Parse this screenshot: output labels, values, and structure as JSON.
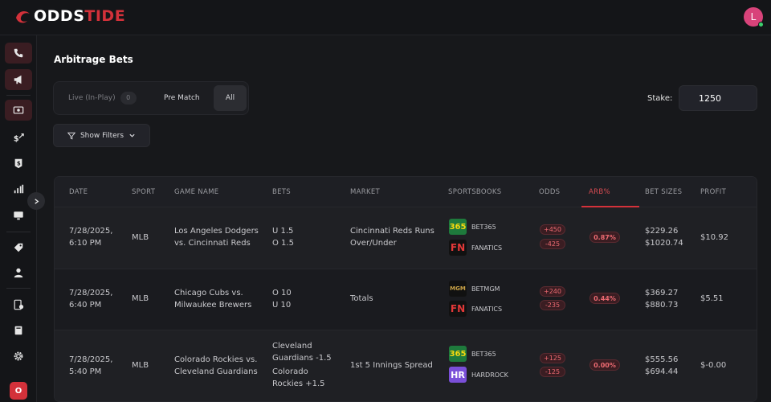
{
  "brand": {
    "logo_prefix": "ODDS",
    "logo_suffix": "TIDE"
  },
  "user": {
    "avatar_initial": "L"
  },
  "page": {
    "title": "Arbitrage Bets"
  },
  "mode_tabs": {
    "live_label": "Live (In-Play)",
    "live_count": "0",
    "prematch_label": "Pre Match",
    "all_label": "All",
    "selected": "All"
  },
  "stake": {
    "label": "Stake:",
    "value": "1250"
  },
  "filters": {
    "label": "Show Filters"
  },
  "sidebar_bottom": {
    "label": "O"
  },
  "table": {
    "headers": {
      "date": "DATE",
      "sport": "SPORT",
      "game": "GAME NAME",
      "bets": "BETS",
      "market": "MARKET",
      "books": "SPORTSBOOKS",
      "odds": "ODDS",
      "arb": "ARB%",
      "sizes": "BET SIZES",
      "profit": "PROFIT"
    },
    "rows": [
      {
        "date": "7/28/2025,",
        "time": "6:10 PM",
        "sport": "MLB",
        "game1": "Los Angeles Dodgers",
        "game2": "vs. Cincinnati Reds",
        "bet1": "U 1.5",
        "bet2": "O 1.5",
        "market1": "Cincinnati Reds Runs",
        "market2": "Over/Under",
        "book1_logo": "365",
        "book1": "BET365",
        "book2_logo": "FN",
        "book2": "FANATICS",
        "odds1": "+450",
        "odds2": "-425",
        "arb": "0.87%",
        "size1": "$229.26",
        "size2": "$1020.74",
        "profit": "$10.92"
      },
      {
        "date": "7/28/2025,",
        "time": "6:40 PM",
        "sport": "MLB",
        "game1": "Chicago Cubs vs.",
        "game2": "Milwaukee Brewers",
        "bet1": "O 10",
        "bet2": "U 10",
        "market1": "Totals",
        "book1_logo": "MGM",
        "book1": "BETMGM",
        "book2_logo": "FN",
        "book2": "FANATICS",
        "odds1": "+240",
        "odds2": "-235",
        "arb": "0.44%",
        "size1": "$369.27",
        "size2": "$880.73",
        "profit": "$5.51"
      },
      {
        "date": "7/28/2025,",
        "time": "5:40 PM",
        "sport": "MLB",
        "game1": "Colorado Rockies vs.",
        "game2": "Cleveland Guardians",
        "bet1a": "Cleveland",
        "bet1b": "Guardians -1.5",
        "bet2a": "Colorado",
        "bet2b": "Rockies +1.5",
        "market1": "1st 5 Innings Spread",
        "book1_logo": "365",
        "book1": "BET365",
        "book2_logo": "HR",
        "book2": "HARDROCK",
        "odds1": "+125",
        "odds2": "-125",
        "arb": "0.00%",
        "size1": "$555.56",
        "size2": "$694.44",
        "profit": "$-0.00"
      }
    ]
  },
  "colors": {
    "accent": "#d3313a",
    "background": "#17181b",
    "odds_text": "#ee6b72"
  }
}
